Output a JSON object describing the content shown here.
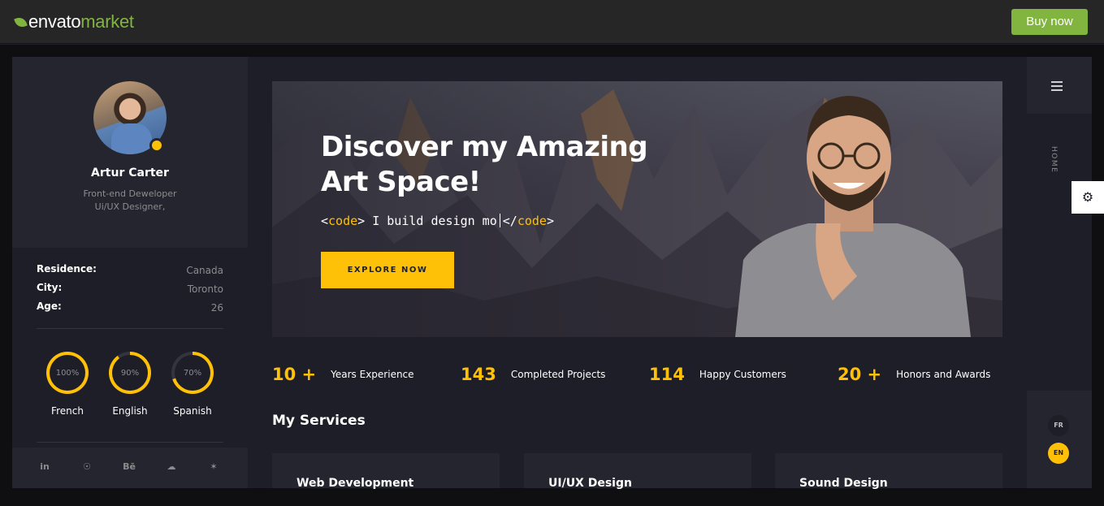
{
  "topbar": {
    "logo_part1": "envato",
    "logo_part2": "market",
    "buy_label": "Buy now"
  },
  "profile": {
    "name": "Artur Carter",
    "role_line1": "Front-end Deweloper",
    "role_line2": "Ui/UX Designer,",
    "details": [
      {
        "key": "Residence:",
        "value": "Canada"
      },
      {
        "key": "City:",
        "value": "Toronto"
      },
      {
        "key": "Age:",
        "value": "26"
      }
    ],
    "languages": [
      {
        "name": "French",
        "percent_label": "100%",
        "percent": 100
      },
      {
        "name": "English",
        "percent_label": "90%",
        "percent": 90
      },
      {
        "name": "Spanish",
        "percent_label": "70%",
        "percent": 70
      }
    ],
    "social": [
      "in",
      "☉",
      "Bē",
      "☁",
      "✶"
    ]
  },
  "hero": {
    "title_line1": "Discover my Amazing",
    "title_line2": "Art Space!",
    "code_open": "<code>",
    "code_text": " I build design mo",
    "code_close": "</code>",
    "explore_label": "EXPLORE NOW"
  },
  "stats": [
    {
      "number": "10 +",
      "label": "Years Experience"
    },
    {
      "number": "143",
      "label": "Completed Projects"
    },
    {
      "number": "114",
      "label": "Happy Customers"
    },
    {
      "number": "20 +",
      "label": "Honors and Awards"
    }
  ],
  "services": {
    "title": "My Services",
    "cards": [
      "Web Development",
      "UI/UX Design",
      "Sound Design"
    ]
  },
  "nav": {
    "home_label": "HOME",
    "lang_fr": "FR",
    "lang_en": "EN"
  },
  "colors": {
    "accent": "#ffc107",
    "envato_green": "#82b440",
    "panel": "#1e1e28",
    "panel_light": "#252530"
  }
}
